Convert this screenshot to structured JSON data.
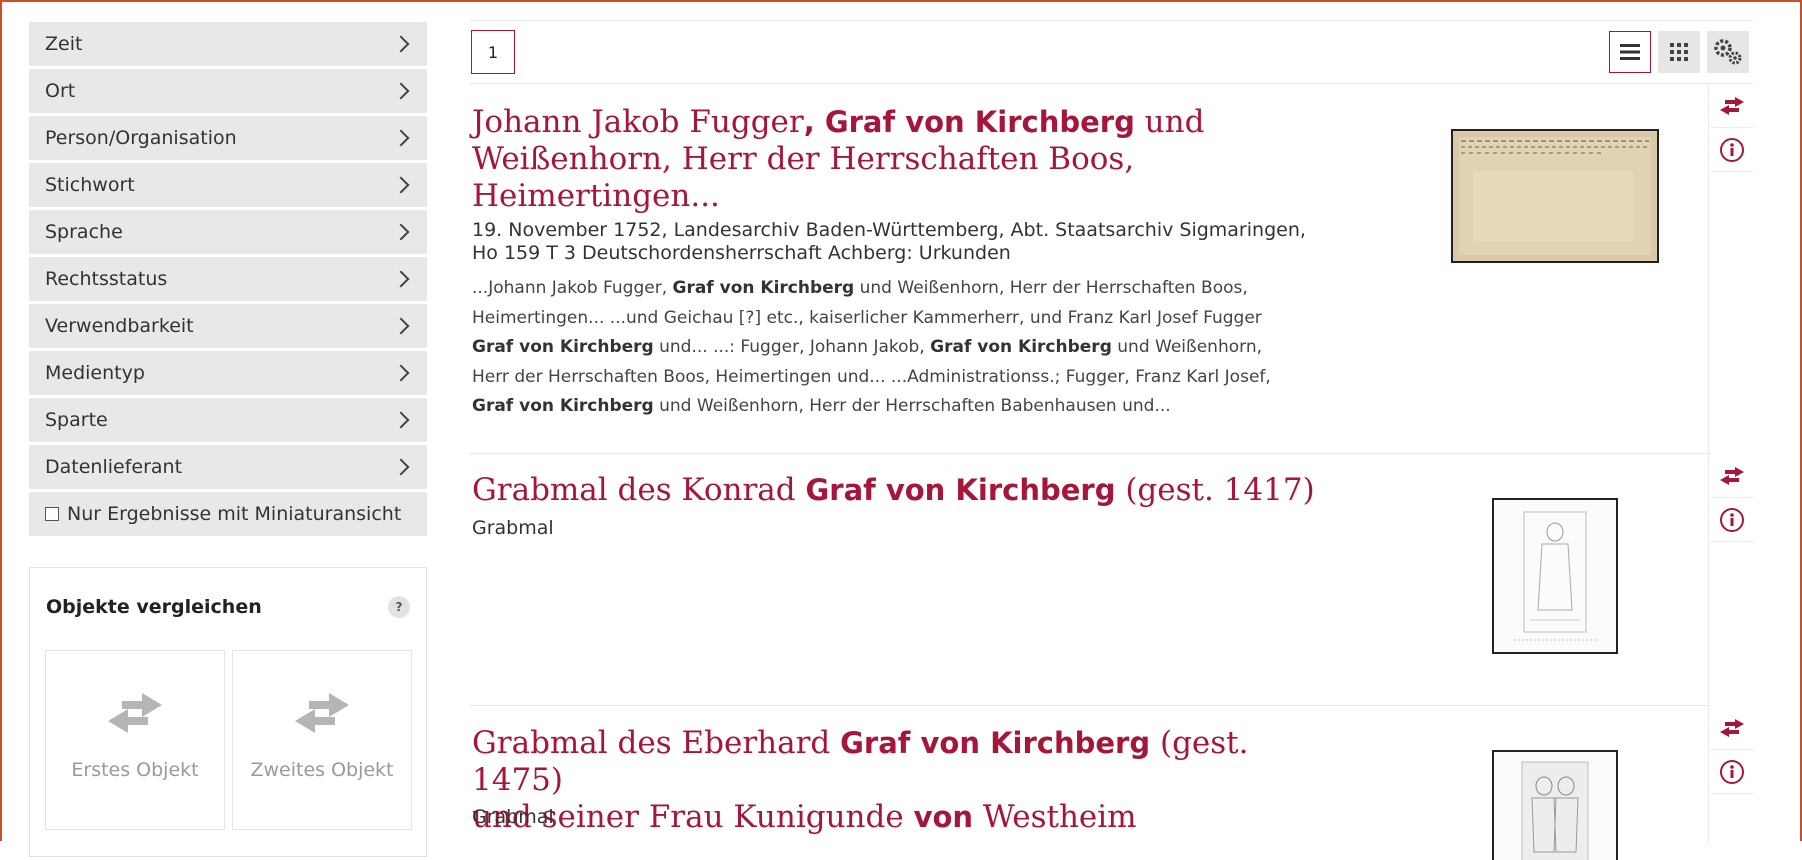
{
  "facets": [
    {
      "label": "Zeit"
    },
    {
      "label": "Ort"
    },
    {
      "label": "Person/Organisation"
    },
    {
      "label": "Stichwort"
    },
    {
      "label": "Sprache"
    },
    {
      "label": "Rechtsstatus"
    },
    {
      "label": "Verwendbarkeit"
    },
    {
      "label": "Medientyp"
    },
    {
      "label": "Sparte"
    },
    {
      "label": "Datenlieferant"
    }
  ],
  "thumb_filter": {
    "label": "Nur Ergebnisse mit Miniaturansicht",
    "checked": false
  },
  "compare": {
    "title": "Objekte vergleichen",
    "help": "?",
    "first": "Erstes Objekt",
    "second": "Zweites Objekt"
  },
  "pagination": {
    "current": "1"
  },
  "view_modes": {
    "active": "list",
    "icons": [
      "list-view-icon",
      "grid-view-icon",
      "settings-icon"
    ]
  },
  "colors": {
    "accent": "#a6163a",
    "frame": "#c8502a",
    "facet_bg": "#eae8e6"
  },
  "results": [
    {
      "title_parts": [
        "Johann Jakob Fugger",
        ", Graf von Kirchberg",
        " und Weißenhorn, Herr der Herrschaften Boos, Heimertingen..."
      ],
      "meta": "19. November 1752, Landesarchiv Baden-Württemberg, Abt. Staatsarchiv Sigmaringen, Ho 159 T 3 Deutschordensherrschaft Achberg: Urkunden",
      "snippet": [
        "...Johann Jakob Fugger, ",
        "Graf von Kirchberg",
        " und Weißenhorn, Herr der Herrschaften Boos, Heimertingen... ...und Geichau [?] etc., kaiserlicher Kammerherr, und Franz Karl Josef Fugger ",
        "Graf von Kirchberg",
        " und... ...: Fugger, Johann Jakob, ",
        "Graf von Kirchberg",
        " und Weißenhorn, Herr der Herrschaften Boos, Heimertingen und... ...Administrationss.; Fugger, Franz Karl Josef, ",
        "Graf von Kirchberg",
        " und Weißenhorn, Herr der Herrschaften Babenhausen und..."
      ]
    },
    {
      "title_parts": [
        "Grabmal des Konrad ",
        "Graf von Kirchberg",
        " (gest. 1417)"
      ],
      "meta": "Grabmal"
    },
    {
      "title_parts": [
        "Grabmal des Eberhard ",
        "Graf von Kirchberg",
        " (gest. 1475)",
        "und seiner Frau Kunigunde ",
        "von",
        " Westheim"
      ],
      "meta": "Grabmal"
    }
  ]
}
